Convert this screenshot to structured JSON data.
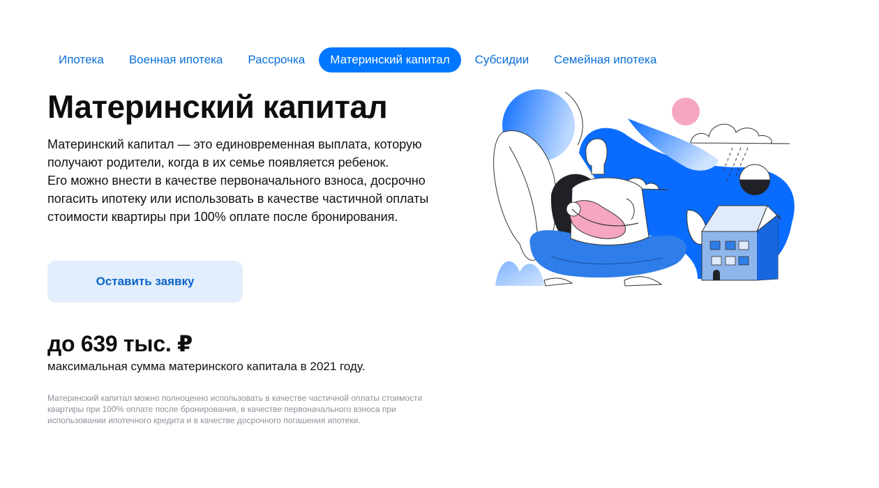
{
  "tabs": [
    {
      "label": "Ипотека",
      "active": false
    },
    {
      "label": "Военная ипотека",
      "active": false
    },
    {
      "label": "Рассрочка",
      "active": false
    },
    {
      "label": "Материнский капитал",
      "active": true
    },
    {
      "label": "Субсидии",
      "active": false
    },
    {
      "label": "Семейная ипотека",
      "active": false
    }
  ],
  "main": {
    "title": "Материнский капитал",
    "desc_line1": "Материнский капитал — это единовременная выплата, которую получают родители, когда в их семье появляется ребенок.",
    "desc_line2": "Его можно внести в качестве первоначального взноса, досрочно погасить ипотеку или использовать в качестве частичной оплаты стоимости квартиры при 100% оплате после бронирования.",
    "cta_label": "Оставить заявку",
    "amount": "до 639 тыс. ₽",
    "amount_caption": "максимальная сумма материнского капитала в 2021 году.",
    "footnote": "Материнский капитал можно полноценно использовать в качестве частичной оплаты стоимости квартиры при 100% оплате после бронирования, в качестве первоначального взноса при использовании ипотечного кредита и в качестве досрочного погашения ипотеки."
  },
  "colors": {
    "accent": "#0077ff",
    "link": "#0a6fd8",
    "cta_bg": "#e2eefc",
    "pink": "#f6a6bf",
    "muted": "#8b9099"
  },
  "illustration": {
    "icon": "mother-with-baby-house-illustration"
  }
}
